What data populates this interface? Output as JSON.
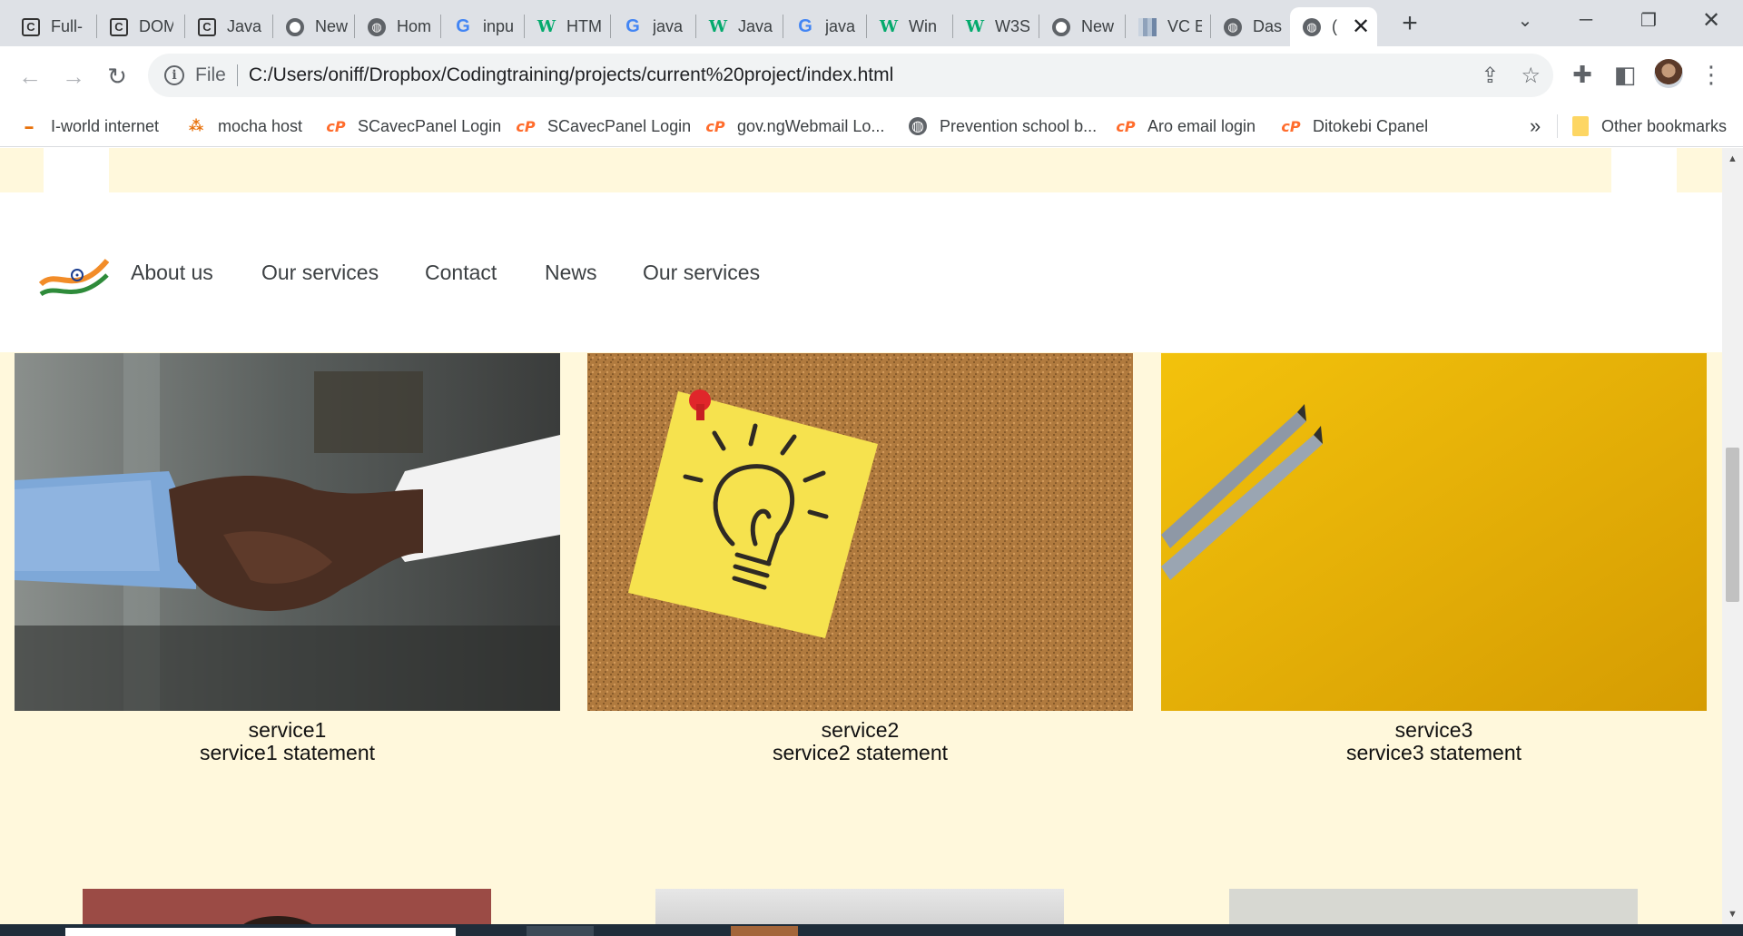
{
  "browser": {
    "tabs": [
      {
        "icon": "codepen-icon",
        "title": "Full-"
      },
      {
        "icon": "codepen-icon",
        "title": "DOM"
      },
      {
        "icon": "codepen-icon",
        "title": "Java"
      },
      {
        "icon": "chrome-icon",
        "title": "New"
      },
      {
        "icon": "globe-icon",
        "title": "Hom"
      },
      {
        "icon": "google-icon",
        "title": "inpu"
      },
      {
        "icon": "w3schools-icon",
        "title": "HTM"
      },
      {
        "icon": "google-icon",
        "title": "java"
      },
      {
        "icon": "w3schools-icon",
        "title": "Java"
      },
      {
        "icon": "google-icon",
        "title": "java"
      },
      {
        "icon": "w3schools-icon",
        "title": "Win"
      },
      {
        "icon": "w3schools-icon",
        "title": "W3S"
      },
      {
        "icon": "chrome-icon",
        "title": "New"
      },
      {
        "icon": "chart-icon",
        "title": "VC E"
      },
      {
        "icon": "globe-icon",
        "title": "Das"
      },
      {
        "icon": "globe-icon",
        "title": "("
      }
    ],
    "url_scheme": "File",
    "url": "C:/Users/oniff/Dropbox/Codingtraining/projects/current%20project/index.html",
    "bookmarks": [
      {
        "icon": "iworld-icon",
        "label": "I-world internet"
      },
      {
        "icon": "mocha-icon",
        "label": "mocha host"
      },
      {
        "icon": "cpanel-icon",
        "label": "SCavecPanel Login"
      },
      {
        "icon": "cpanel-icon",
        "label": "SCavecPanel Login"
      },
      {
        "icon": "cpanel-icon",
        "label": "gov.ngWebmail Lo..."
      },
      {
        "icon": "globe-icon",
        "label": "Prevention school b..."
      },
      {
        "icon": "cpanel-icon",
        "label": "Aro email login"
      },
      {
        "icon": "cpanel-icon",
        "label": "Ditokebi Cpanel"
      }
    ],
    "more_bookmarks": "»",
    "other_bookmarks": "Other bookmarks"
  },
  "page": {
    "nav": [
      "About us",
      "Our services",
      "Contact",
      "News",
      "Our services"
    ],
    "services": [
      {
        "title": "service1",
        "statement": "service1 statement",
        "image": "handshake-photo"
      },
      {
        "title": "service2",
        "statement": "service2 statement",
        "image": "lightbulb-note-photo"
      },
      {
        "title": "service3",
        "statement": "service3 statement",
        "image": "pencils-photo"
      }
    ]
  },
  "colors": {
    "page_bg": "#fff8dc",
    "chrome_bg": "#dee1e6",
    "nav_text": "#3c4043"
  }
}
